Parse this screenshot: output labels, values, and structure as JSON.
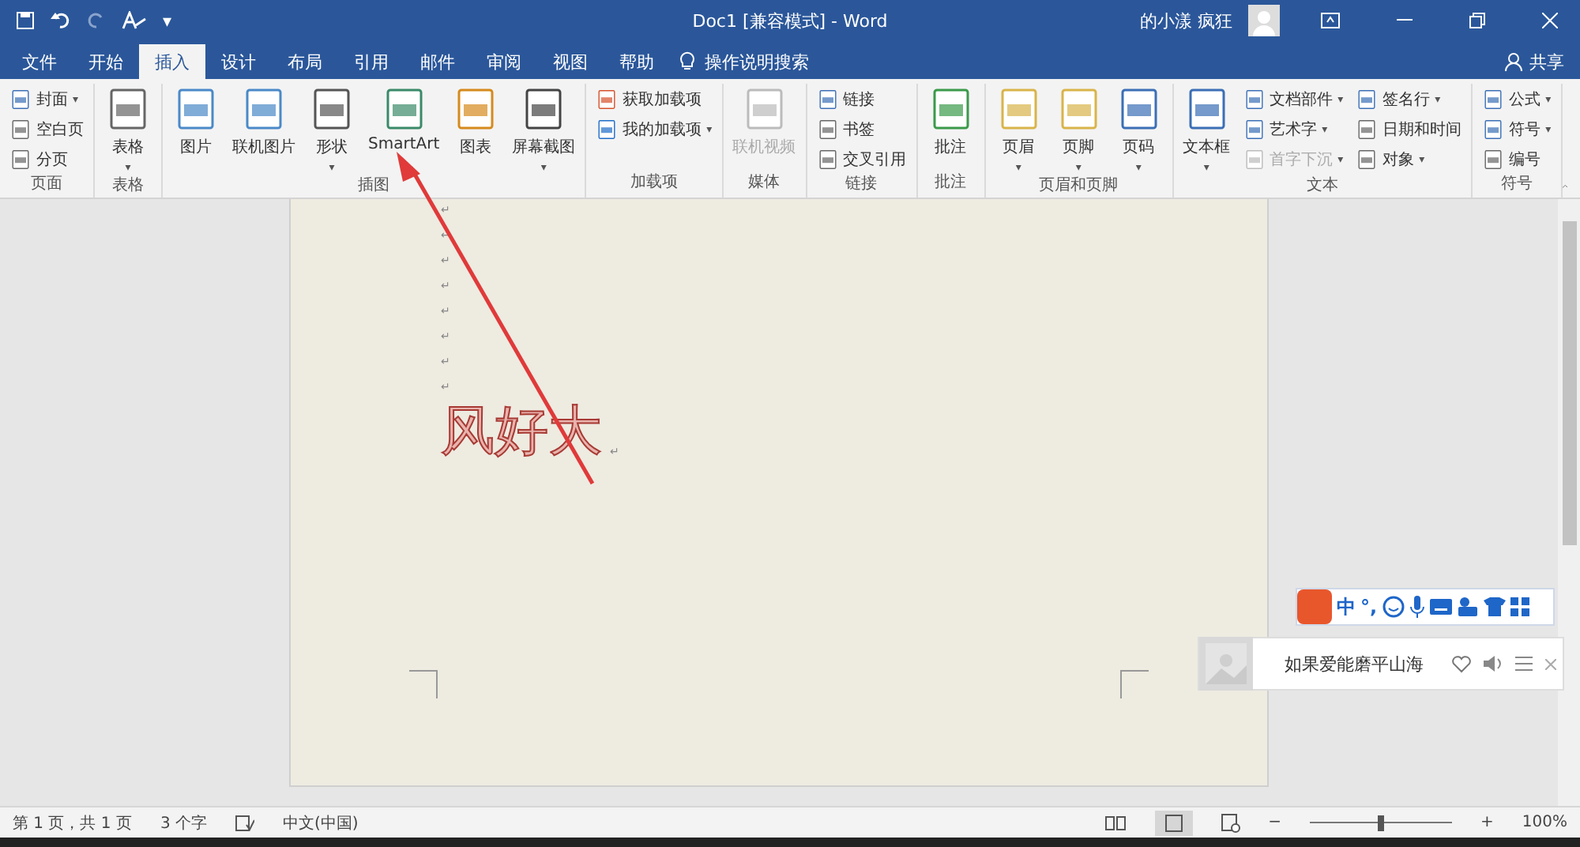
{
  "title_bar": {
    "title": "Doc1 [兼容模式] - Word",
    "user": "的小漾 疯狂",
    "quick_access_dropdown": "▾"
  },
  "tabs": [
    {
      "label": "文件",
      "selected": false
    },
    {
      "label": "开始",
      "selected": false
    },
    {
      "label": "插入",
      "selected": true
    },
    {
      "label": "设计",
      "selected": false
    },
    {
      "label": "布局",
      "selected": false
    },
    {
      "label": "引用",
      "selected": false
    },
    {
      "label": "邮件",
      "selected": false
    },
    {
      "label": "审阅",
      "selected": false
    },
    {
      "label": "视图",
      "selected": false
    },
    {
      "label": "帮助",
      "selected": false
    }
  ],
  "tell_me": "操作说明搜索",
  "share": "共享",
  "ribbon_groups": [
    {
      "name": "页面",
      "columns": [
        [
          {
            "label": "封面",
            "kind": "small",
            "caret": "▾",
            "disabled": false
          },
          {
            "label": "空白页",
            "kind": "small",
            "disabled": false
          },
          {
            "label": "分页",
            "kind": "small",
            "disabled": false
          }
        ]
      ]
    },
    {
      "name": "表格",
      "columns": [
        [
          {
            "label": "表格",
            "kind": "large",
            "caret": "▾",
            "disabled": false
          }
        ]
      ]
    },
    {
      "name": "插图",
      "columns": [
        [
          {
            "label": "图片",
            "kind": "large",
            "disabled": false
          }
        ],
        [
          {
            "label": "联机图片",
            "kind": "large",
            "disabled": false
          }
        ],
        [
          {
            "label": "形状",
            "kind": "large",
            "caret": "▾",
            "disabled": false
          }
        ],
        [
          {
            "label": "SmartArt",
            "kind": "large",
            "disabled": false
          }
        ],
        [
          {
            "label": "图表",
            "kind": "large",
            "disabled": false
          }
        ],
        [
          {
            "label": "屏幕截图",
            "kind": "large",
            "caret": "▾",
            "disabled": false
          }
        ]
      ]
    },
    {
      "name": "加载项",
      "columns": [
        [
          {
            "label": "获取加载项",
            "kind": "small",
            "disabled": false
          },
          {
            "label": "我的加载项",
            "kind": "small",
            "caret": "▾",
            "disabled": false
          }
        ]
      ]
    },
    {
      "name": "媒体",
      "columns": [
        [
          {
            "label": "联机视频",
            "kind": "large",
            "disabled": true
          }
        ]
      ]
    },
    {
      "name": "链接",
      "columns": [
        [
          {
            "label": "链接",
            "kind": "small",
            "disabled": false
          },
          {
            "label": "书签",
            "kind": "small",
            "disabled": false
          },
          {
            "label": "交叉引用",
            "kind": "small",
            "disabled": false
          }
        ]
      ]
    },
    {
      "name": "批注",
      "columns": [
        [
          {
            "label": "批注",
            "kind": "large",
            "disabled": false
          }
        ]
      ]
    },
    {
      "name": "页眉和页脚",
      "columns": [
        [
          {
            "label": "页眉",
            "kind": "large",
            "caret": "▾",
            "disabled": false
          }
        ],
        [
          {
            "label": "页脚",
            "kind": "large",
            "caret": "▾",
            "disabled": false
          }
        ],
        [
          {
            "label": "页码",
            "kind": "large",
            "caret": "▾",
            "disabled": false
          }
        ]
      ]
    },
    {
      "name": "文本",
      "columns": [
        [
          {
            "label": "文本框",
            "kind": "large",
            "caret": "▾",
            "disabled": false
          }
        ],
        [
          {
            "label": "文档部件",
            "kind": "small",
            "caret": "▾",
            "disabled": false
          },
          {
            "label": "艺术字",
            "kind": "small",
            "caret": "▾",
            "disabled": false
          },
          {
            "label": "首字下沉",
            "kind": "small",
            "caret": "▾",
            "disabled": true
          }
        ],
        [
          {
            "label": "签名行",
            "kind": "small",
            "caret": "▾",
            "disabled": false
          },
          {
            "label": "日期和时间",
            "kind": "small",
            "disabled": false
          },
          {
            "label": "对象",
            "kind": "small",
            "caret": "▾",
            "disabled": false
          }
        ]
      ]
    },
    {
      "name": "符号",
      "columns": [
        [
          {
            "label": "公式",
            "kind": "small",
            "caret": "▾",
            "disabled": false
          },
          {
            "label": "符号",
            "kind": "small",
            "caret": "▾",
            "disabled": false
          },
          {
            "label": "编号",
            "kind": "small",
            "disabled": false
          }
        ]
      ]
    }
  ],
  "document": {
    "paragraph_marks": [
      "↵",
      "↵",
      "↵",
      "↵",
      "↵",
      "↵",
      "↵",
      "↵"
    ],
    "text": "风好大",
    "text_mark": "↵"
  },
  "ime_bar": {
    "mode": "中",
    "punctuation": "°,"
  },
  "music_widget": {
    "song": "如果爱能磨平山海"
  },
  "status_bar": {
    "page": "第 1 页，共 1 页",
    "words": "3 个字",
    "language": "中文(中国)",
    "zoom_out": "−",
    "zoom_slider": {
      "level": 0.5
    },
    "zoom_in": "+",
    "zoom": "100%"
  }
}
